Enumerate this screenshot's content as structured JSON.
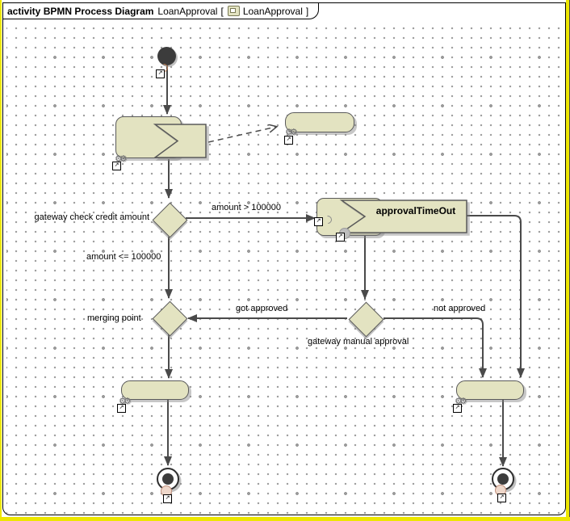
{
  "window": {
    "tab_title_bold": "activity BPMN Process Diagram",
    "tab_model_name": "LoanApproval",
    "tab_bracket_open": "[",
    "tab_ref_name": "LoanApproval",
    "tab_bracket_close": "]"
  },
  "nodes": {
    "timeout_label": "approvalTimeOut"
  },
  "edge_labels": {
    "credit_gateway": "gateway check credit amount",
    "amount_gt": "amount > 100000",
    "amount_le": "amount <= 100000",
    "merging_point": "merging point",
    "got_approved": "got approved",
    "not_approved": "not approved",
    "manual_gateway": "gateway manual approval"
  },
  "icons": {
    "gears": "⚙⚙",
    "link": "↗"
  },
  "colors": {
    "node_fill": "#e3e3c1",
    "node_border": "#5a5a5a",
    "edge": "#4a4a4a",
    "frame_border": "#000000",
    "selection_yellow": "#ede600",
    "grid_dot": "#9c9c9c",
    "initial_fill": "#3c3c3c"
  }
}
